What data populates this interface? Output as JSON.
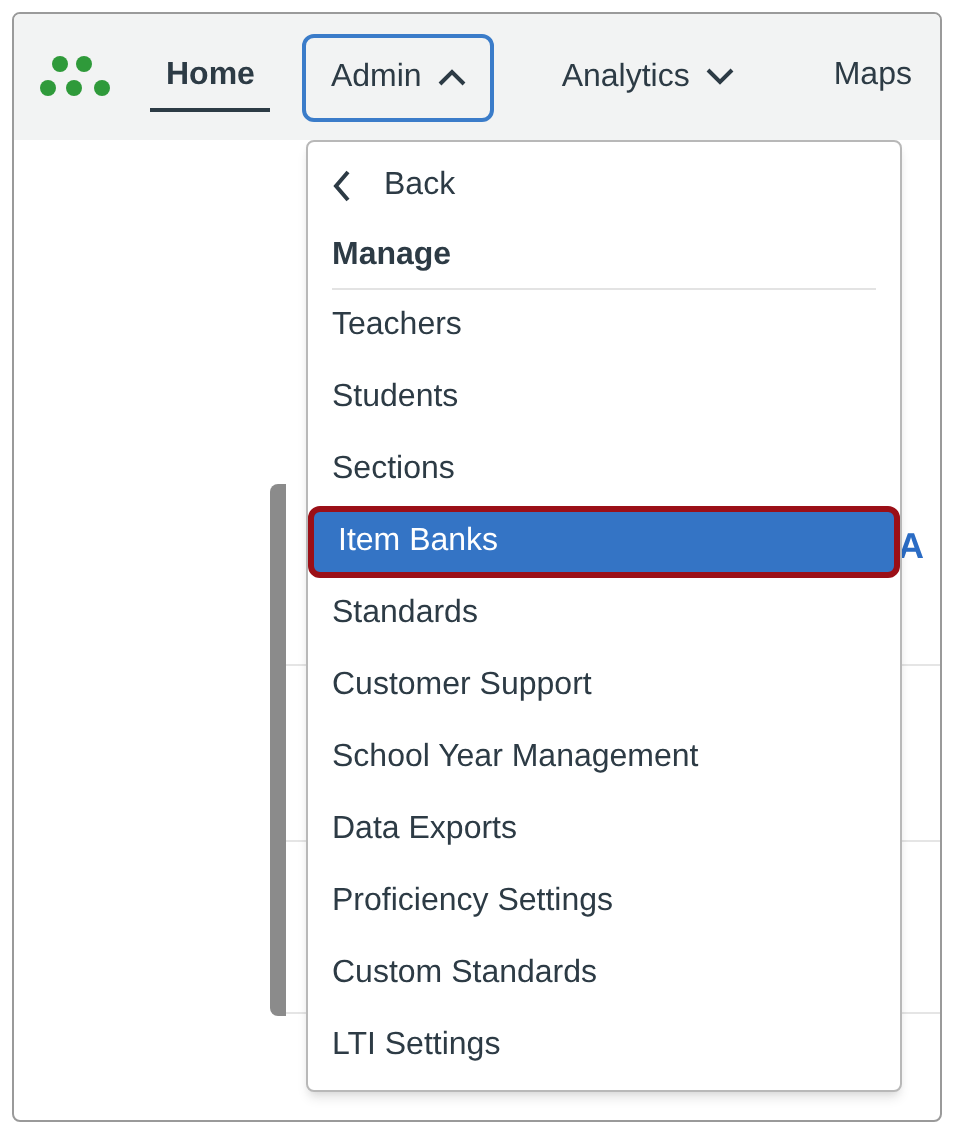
{
  "nav": {
    "items": [
      {
        "label": "Home",
        "kind": "link",
        "selected": true
      },
      {
        "label": "Admin",
        "kind": "dropdown",
        "selected": false,
        "expanded": true
      },
      {
        "label": "Analytics",
        "kind": "dropdown",
        "selected": false,
        "expanded": false
      },
      {
        "label": "Maps",
        "kind": "link",
        "selected": false
      }
    ]
  },
  "page": {
    "link_fragment": "A"
  },
  "menu": {
    "back": "Back",
    "heading": "Manage",
    "items": [
      {
        "label": "Teachers",
        "selected": false
      },
      {
        "label": "Students",
        "selected": false
      },
      {
        "label": "Sections",
        "selected": false
      },
      {
        "label": "Item Banks",
        "selected": true
      },
      {
        "label": "Standards",
        "selected": false
      },
      {
        "label": "Customer Support",
        "selected": false
      },
      {
        "label": "School Year Management",
        "selected": false
      },
      {
        "label": "Data Exports",
        "selected": false
      },
      {
        "label": "Proficiency Settings",
        "selected": false
      },
      {
        "label": "Custom Standards",
        "selected": false
      },
      {
        "label": "LTI Settings",
        "selected": false
      }
    ]
  }
}
